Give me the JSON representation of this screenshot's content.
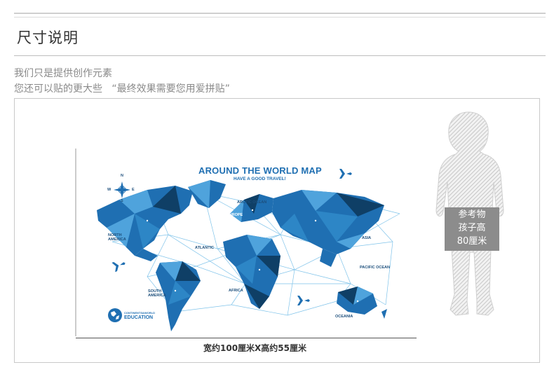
{
  "header": {
    "title": "尺寸说明"
  },
  "notes": {
    "line1": "我们只是提供创作元素",
    "line2": "您还可以贴的更大些   “最终效果需要您用爱拼贴”"
  },
  "map": {
    "title": "AROUND THE WORLD MAP",
    "subtitle": "HAVE A GOOD TRAVEL!",
    "compass": {
      "n": "N",
      "s": "S",
      "e": "E",
      "w": "W"
    },
    "labels": {
      "arctic_ocean": "ARCTIC OCEAN",
      "europe": "EUROPE",
      "asia": "ASIA",
      "north_america_1": "NORTH",
      "north_america_2": "AMERICA",
      "atlantic": "ATLANTIC",
      "pacific": "PACIFIC OCEAN",
      "south_america_1": "SOUTH",
      "south_america_2": "AMERICA",
      "africa": "AFRICA",
      "oceania": "OCEANIA"
    },
    "badge": {
      "small": "CONTINENTS&WORLD",
      "big": "EDUCATION"
    },
    "colors": {
      "dark": "#0f3f66",
      "mid": "#1f6fb2",
      "light": "#4fa3dc",
      "lines": "#7fc3ea"
    }
  },
  "dimension": {
    "caption": "宽约100厘米X高约55厘米"
  },
  "reference": {
    "line1": "参考物",
    "line2": "孩子高",
    "line3": "80厘米"
  }
}
